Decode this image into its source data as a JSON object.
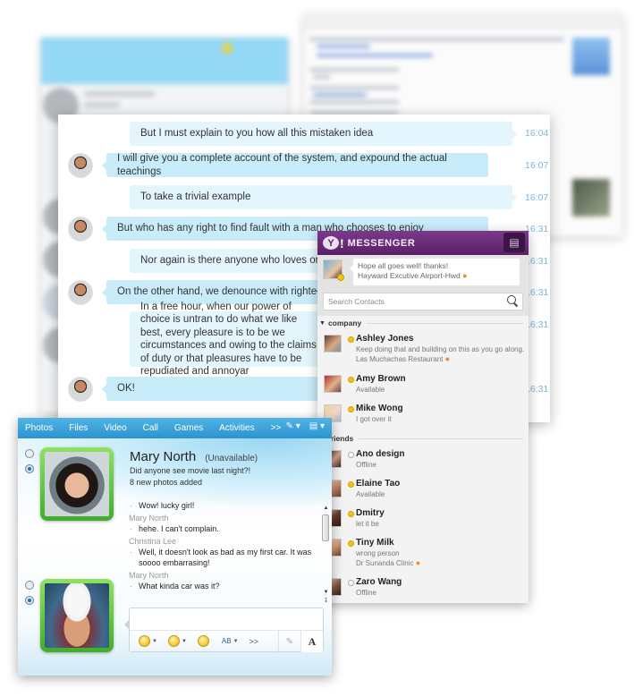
{
  "background_windows": {
    "skype_like": {
      "description": "blurred contact window"
    },
    "email_client": {
      "description": "blurred conversation window"
    }
  },
  "chat_window": {
    "messages": [
      {
        "side": "mine",
        "text": "But I must explain to you how all this mistaken idea",
        "time": "16:04"
      },
      {
        "side": "theirs",
        "text": "I will give you a complete account of the system, and expound the actual teachings",
        "time": "16:07"
      },
      {
        "side": "mine",
        "text": "To take a trivial example",
        "time": "16:07"
      },
      {
        "side": "theirs",
        "text": "But who has any right to find fault with a man who chooses to enjoy",
        "time": "16:31"
      },
      {
        "side": "mine",
        "text": "Nor again is there anyone who loves or pursues or",
        "time": "16:31"
      },
      {
        "side": "theirs",
        "text": "On the other hand, we denounce with righteous indignat",
        "time": "16:31"
      },
      {
        "side": "mine",
        "text": "In a free hour, when our power of choice is untran to do what we like best, every pleasure is to be we circumstances and owing to the claims of duty or that pleasures have to be repudiated and annoyar",
        "time": "16:31"
      },
      {
        "side": "theirs",
        "text": "OK!",
        "time": "16:31"
      }
    ]
  },
  "yahoo_messenger": {
    "title": "MESSENGER",
    "logo": "Y!",
    "chat_button_icon": "chat-bubbles-icon",
    "my_status": {
      "message": "Hope all goes well!  thanks!",
      "location": "Hayward Excutive Airport-Hwd"
    },
    "search_placeholder": "Search Contacts",
    "groups": [
      {
        "name": "company",
        "contacts": [
          {
            "name": "Ashley Jones",
            "status": "online",
            "message": "Keep doing that and building on this as you go along.",
            "location": "Las Muchachas Restaurant"
          },
          {
            "name": "Amy Brown",
            "status": "online",
            "message": "Available"
          },
          {
            "name": "Mike Wong",
            "status": "online",
            "message": "I got over it"
          }
        ]
      },
      {
        "name": "friends",
        "contacts": [
          {
            "name": "Ano design",
            "status": "offline",
            "message": "Offline"
          },
          {
            "name": "Elaine Tao",
            "status": "online",
            "message": "Available"
          },
          {
            "name": "Dmitry",
            "status": "online",
            "message": "let it be"
          },
          {
            "name": "Tiny Milk",
            "status": "online",
            "message": "wrong person",
            "location": "Dr Sunanda Clinic"
          },
          {
            "name": "Zaro Wang",
            "status": "offline",
            "message": "Offline"
          }
        ]
      }
    ]
  },
  "live_messenger": {
    "toolbar": [
      "Photos",
      "Files",
      "Video",
      "Call",
      "Games",
      "Activities",
      ">>"
    ],
    "contact": {
      "name": "Mary North",
      "availability": "(Unavailable)",
      "personal_message": "Did anyone see movie last night?!",
      "activity": "8 new photos added"
    },
    "conversation": [
      {
        "type": "line",
        "text": "Wow! lucky girl!"
      },
      {
        "type": "sender",
        "text": "Mary North"
      },
      {
        "type": "line",
        "text": "hehe. I can't complain."
      },
      {
        "type": "sender",
        "text": "Christina Lee"
      },
      {
        "type": "line",
        "text": "Well, it doesn't look as bad as my first car. It was soooo embarrasing!"
      },
      {
        "type": "sender",
        "text": "Mary North"
      },
      {
        "type": "line",
        "text": "What kinda car was it?"
      }
    ],
    "format_bar": {
      "more": ">>",
      "font_button": "A",
      "text_style": "AB"
    },
    "colors": {
      "toolbar": "#3aa3d8",
      "frame": "#5cc43d"
    }
  }
}
